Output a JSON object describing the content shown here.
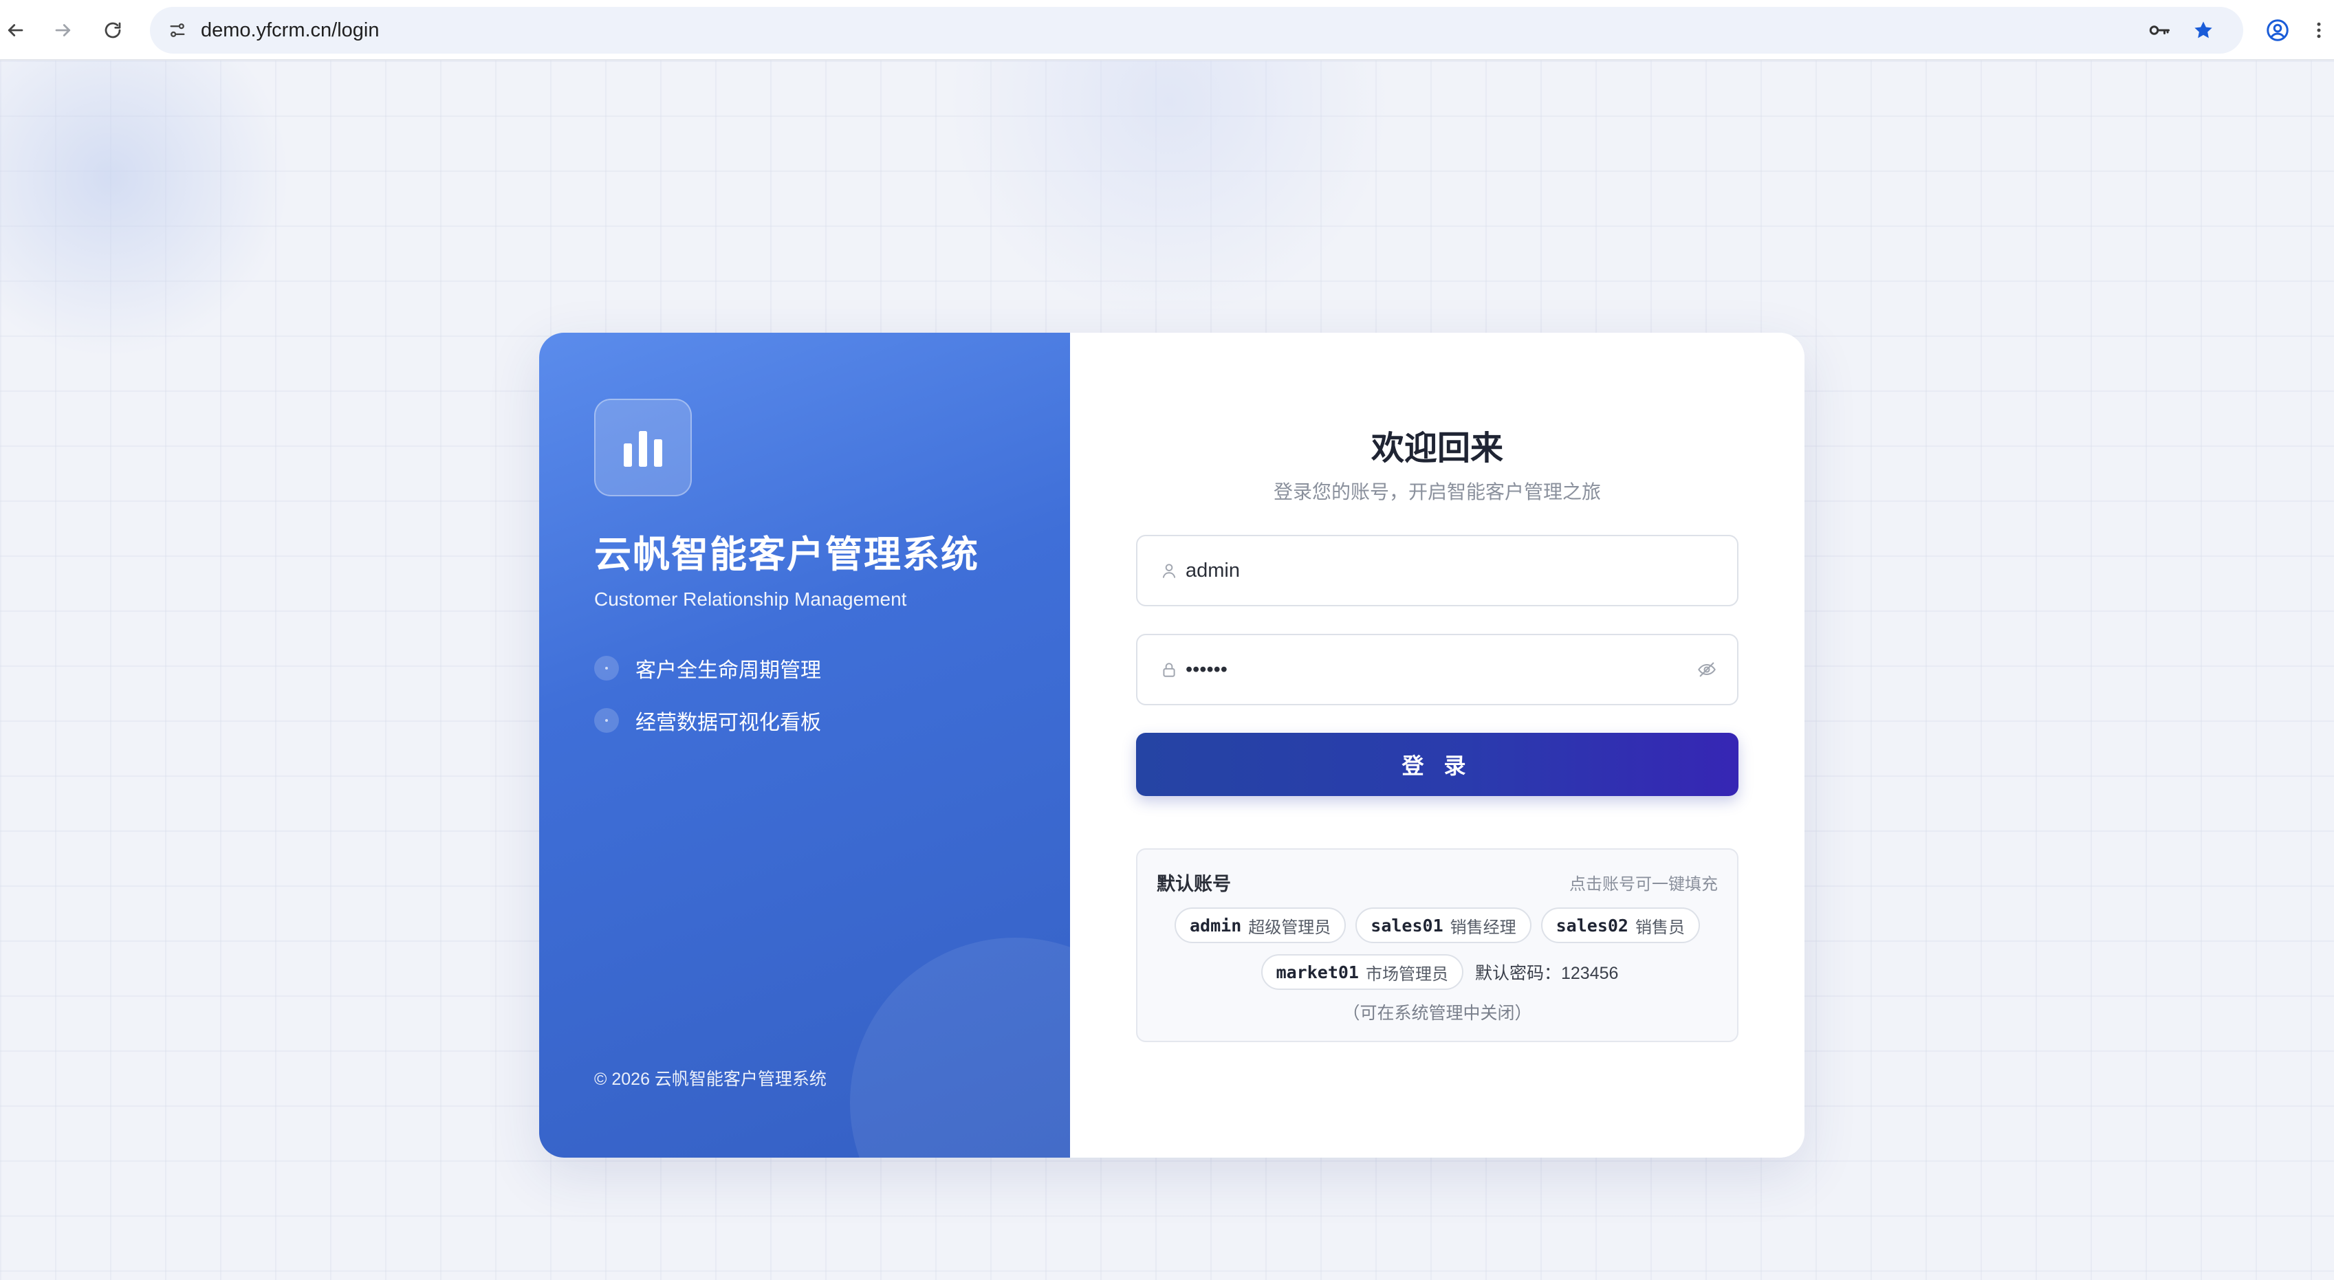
{
  "browser": {
    "url": "demo.yfcrm.cn/login"
  },
  "brand": {
    "title": "云帆智能客户管理系统",
    "subtitle": "Customer Relationship Management",
    "features": [
      "客户全生命周期管理",
      "经营数据可视化看板"
    ],
    "copyright": "© 2026 云帆智能客户管理系统"
  },
  "login": {
    "heading": "欢迎回来",
    "subheading": "登录您的账号，开启智能客户管理之旅",
    "username_value": "admin",
    "password_value": "••••••",
    "submit_label": "登 录"
  },
  "default_accounts": {
    "title": "默认账号",
    "hint": "点击账号可一键填充",
    "accounts": [
      {
        "username": "admin",
        "role": "超级管理员"
      },
      {
        "username": "sales01",
        "role": "销售经理"
      },
      {
        "username": "sales02",
        "role": "销售员"
      },
      {
        "username": "market01",
        "role": "市场管理员"
      }
    ],
    "password_note": "默认密码：123456",
    "close_note": "（可在系统管理中关闭）"
  },
  "colors": {
    "brand_gradient_start": "#5b8cec",
    "brand_gradient_end": "#3560c4",
    "button_gradient_start": "#2544a4",
    "button_gradient_end": "#3626b4",
    "bookmark_star": "#1a5cd8"
  }
}
